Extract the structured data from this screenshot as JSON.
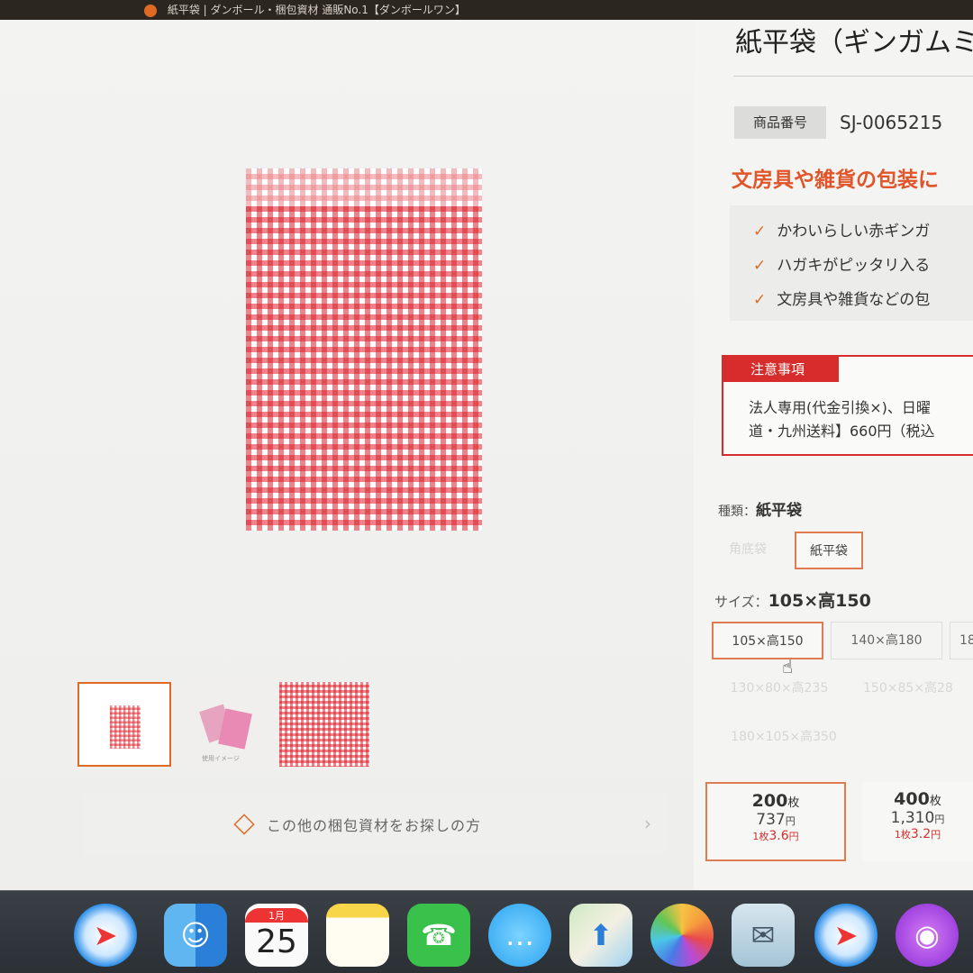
{
  "window": {
    "title": "紙平袋 | ダンボール・梱包資材 通販No.1【ダンボールワン】"
  },
  "product": {
    "title": "紙平袋（ギンガムミ",
    "code_label": "商品番号",
    "code_value": "SJ-0065215",
    "catch": "文房具や雑貨の包装に",
    "features": [
      "かわいらしい赤ギンガ",
      "ハガキがピッタリ入る",
      "文房具や雑貨などの包"
    ],
    "notice_title": "注意事項",
    "notice_lines": [
      "法人専用(代金引換×)、日曜",
      "道・九州送料】660円（税込"
    ]
  },
  "gallery": {
    "thumb2_caption": "使用イメージ"
  },
  "other_link": {
    "label": "この他の梱包資材をお探しの方",
    "arrow": "›"
  },
  "type_selector": {
    "label": "種類：",
    "selected": "紙平袋",
    "options": [
      "角底袋",
      "紙平袋"
    ]
  },
  "size_selector": {
    "label": "サイズ：",
    "selected": "105×高150",
    "options": [
      "105×高150",
      "140×高180",
      "18",
      "130×80×高235",
      "150×85×高28",
      "180×105×高350"
    ]
  },
  "quantities": [
    {
      "count": "200",
      "count_unit": "枚",
      "price": "737",
      "price_unit": "円",
      "unit_prefix": "1枚",
      "unit_price": "3.6",
      "unit_suffix": "円"
    },
    {
      "count": "400",
      "count_unit": "枚",
      "price": "1,310",
      "price_unit": "円",
      "unit_prefix": "1枚",
      "unit_price": "3.2",
      "unit_suffix": "円"
    }
  ],
  "dock": {
    "calendar_month": "1月",
    "calendar_day": "25",
    "icons": [
      "safari-icon",
      "finder-icon",
      "calendar-icon",
      "notes-icon",
      "facetime-icon",
      "messages-icon",
      "maps-icon",
      "photos-icon",
      "mail-icon",
      "safari-icon",
      "podcasts-icon"
    ]
  }
}
